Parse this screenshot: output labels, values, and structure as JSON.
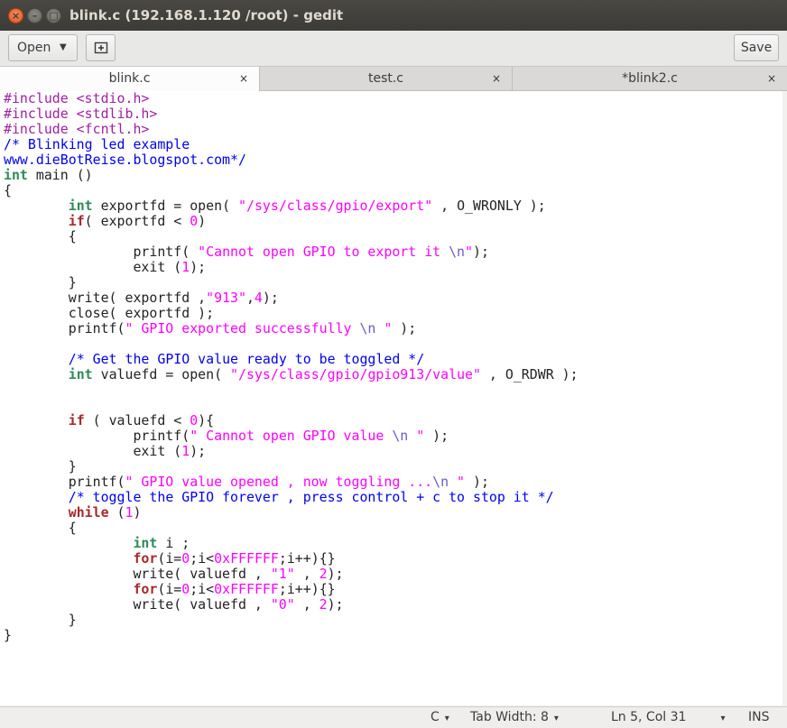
{
  "window": {
    "title": "blink.c (192.168.1.120 /root) - gedit"
  },
  "titlebar_icons": {
    "close": "close-icon",
    "minimize": "minimize-icon",
    "maximize": "maximize-icon"
  },
  "header": {
    "open_label": "Open",
    "new_tab_icon": "new-tab-icon",
    "save_label": "Save"
  },
  "tabs": [
    {
      "label": "blink.c",
      "close": "×"
    },
    {
      "label": "test.c",
      "close": "×"
    },
    {
      "label": "*blink2.c",
      "close": "×"
    }
  ],
  "code": {
    "lines": [
      "#include <stdio.h>",
      "#include <stdlib.h>",
      "#include <fcntl.h>",
      "/* Blinking led example",
      "www.dieBotReise.blogspot.com*/",
      "int main ()",
      "{",
      "        int exportfd = open( \"/sys/class/gpio/export\" , O_WRONLY );",
      "        if( exportfd < 0)",
      "        {",
      "                printf( \"Cannot open GPIO to export it \\n\");",
      "                exit (1);",
      "        }",
      "        write( exportfd ,\"913\",4);",
      "        close( exportfd );",
      "        printf(\" GPIO exported successfully \\n \" );",
      "",
      "        /* Get the GPIO value ready to be toggled */",
      "        int valuefd = open( \"/sys/class/gpio/gpio913/value\" , O_RDWR );",
      "",
      "",
      "        if ( valuefd < 0){",
      "                printf(\" Cannot open GPIO value \\n \" );",
      "                exit (1);",
      "        }",
      "        printf(\" GPIO value opened , now toggling ...\\n \" );",
      "        /* toggle the GPIO forever , press control + c to stop it */",
      "        while (1)",
      "        {",
      "                int i ;",
      "                for(i=0;i<0xFFFFFF;i++){}",
      "                write( valuefd , \"1\" , 2);",
      "                for(i=0;i<0xFFFFFF;i++){}",
      "                write( valuefd , \"0\" , 2);",
      "        }",
      "}"
    ]
  },
  "statusbar": {
    "language": "C",
    "tab_width": "Tab Width: 8",
    "position": "Ln 5, Col 31",
    "mode": "INS",
    "caret": "▾"
  }
}
